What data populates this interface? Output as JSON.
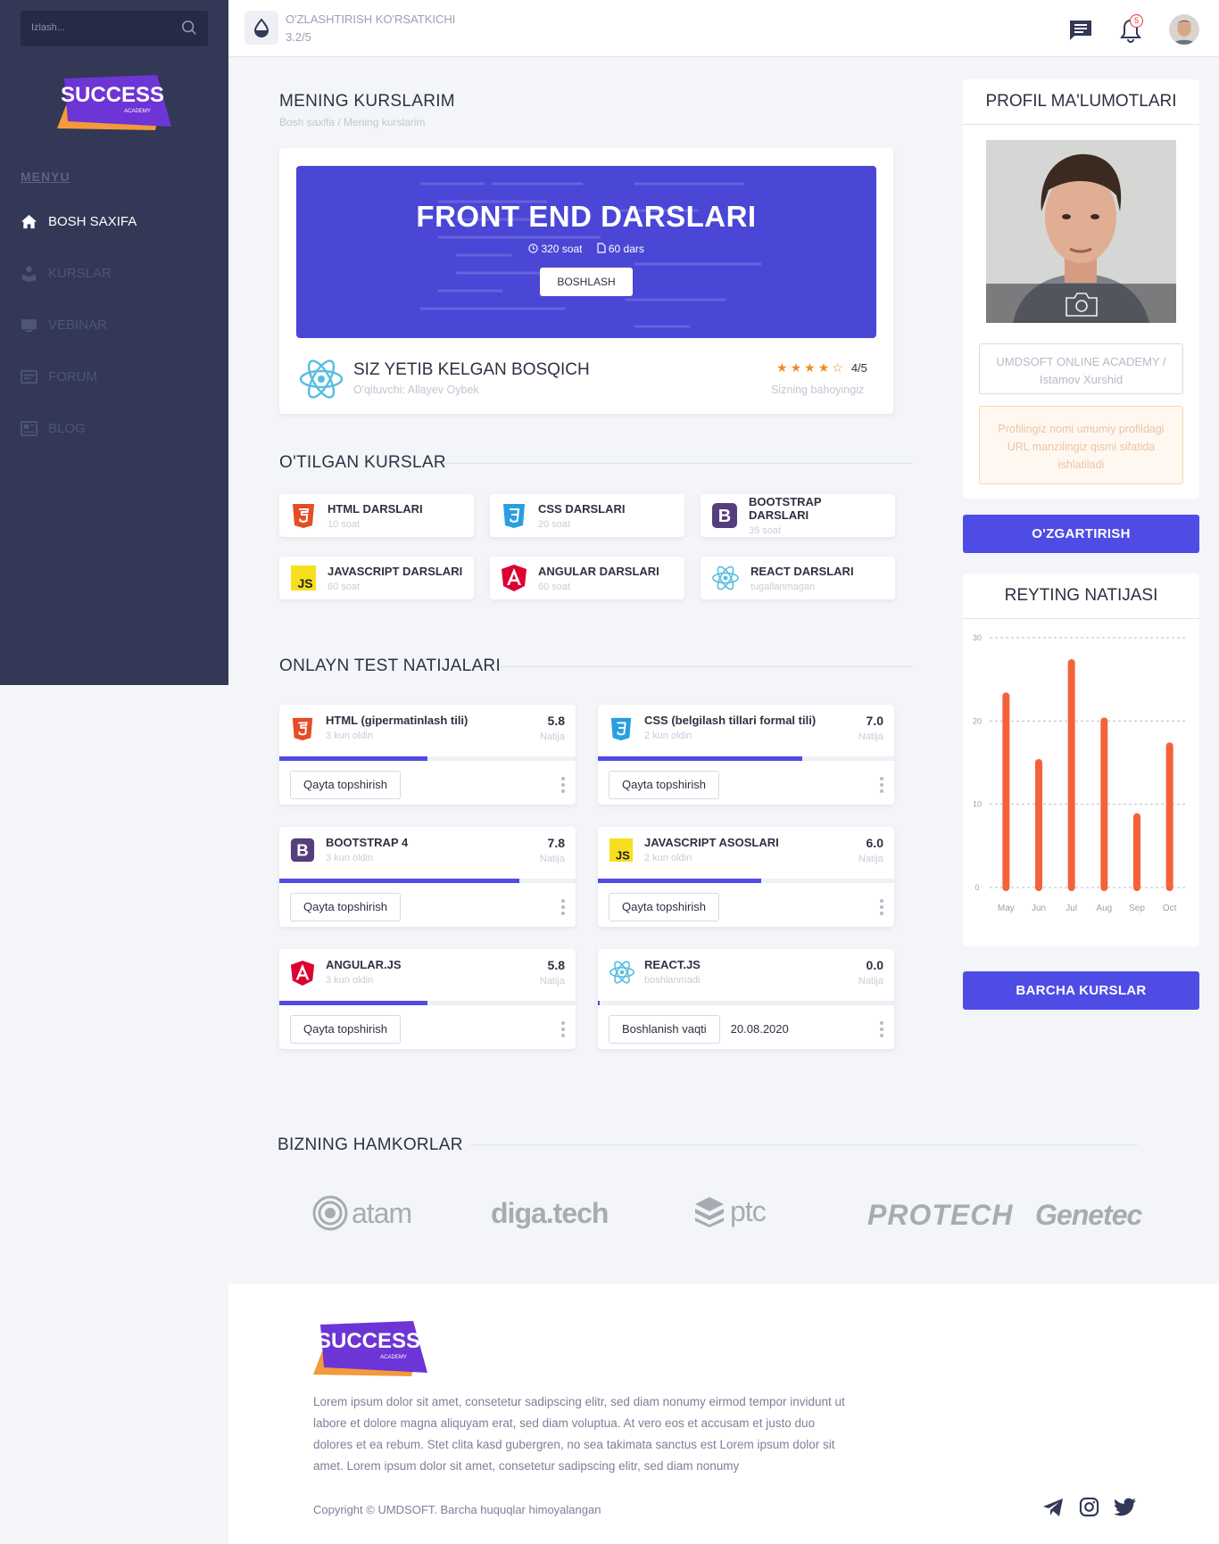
{
  "sidebar": {
    "search_placeholder": "Izlash...",
    "logo_text": "SUCCESS",
    "logo_sub": "ACADEMY",
    "menu_title": "MENYU",
    "items": [
      {
        "label": "BOSH SAXIFA",
        "icon": "home-icon",
        "active": true
      },
      {
        "label": "KURSLAR",
        "icon": "courses-icon",
        "active": false
      },
      {
        "label": "VEBINAR",
        "icon": "webinar-icon",
        "active": false
      },
      {
        "label": "FORUM",
        "icon": "forum-icon",
        "active": false
      },
      {
        "label": "BLOG",
        "icon": "blog-icon",
        "active": false
      }
    ]
  },
  "topbar": {
    "indicator_label": "O'ZLASHTIRISH KO'RSATKICHI",
    "indicator_value": "3.2/5",
    "notification_count": "5"
  },
  "main": {
    "title": "MENING KURSLARIM",
    "breadcrumb": "Bosh saxifa / Mening kurslarim",
    "hero": {
      "title": "FRONT END DARSLARI",
      "hours": "320 soat",
      "lessons": "60 dars",
      "button": "BOSHLASH"
    },
    "progress": {
      "title": "SIZ YETIB KELGAN BOSQICH",
      "teacher": "O'qituvchi: Allayev Oybek",
      "rating": "4/5",
      "rating_value": 4,
      "rating_label": "Sizning bahoyingiz"
    },
    "completed_title": "O'TILGAN KURSLAR",
    "completed": [
      {
        "name": "HTML DARSLARI",
        "sub": "10 soat",
        "icon": "html5-icon"
      },
      {
        "name": "CSS DARSLARI",
        "sub": "20 soat",
        "icon": "css3-icon"
      },
      {
        "name": "BOOTSTRAP DARSLARI",
        "sub": "35 soat",
        "icon": "bootstrap-icon"
      },
      {
        "name": "JAVASCRIPT DARSLARI",
        "sub": "60 soat",
        "icon": "javascript-icon"
      },
      {
        "name": "ANGULAR DARSLARI",
        "sub": "60 soat",
        "icon": "angular-icon"
      },
      {
        "name": "REACT DARSLARI",
        "sub": "tugallanmagan",
        "icon": "react-icon"
      }
    ],
    "tests_title": "ONLAYN TEST NATIJALARI",
    "tests": [
      {
        "name": "HTML (gipermatinlash tili)",
        "sub": "3 kun oldin",
        "score": "5.8",
        "score_label": "Natija",
        "progress": 0.5,
        "action": "Qayta topshirish",
        "date": "",
        "icon": "html5-icon"
      },
      {
        "name": "CSS (belgilash tillari formal tili)",
        "sub": "2 kun oldin",
        "score": "7.0",
        "score_label": "Natija",
        "progress": 0.69,
        "action": "Qayta topshirish",
        "date": "",
        "icon": "css3-icon"
      },
      {
        "name": "BOOTSTRAP 4",
        "sub": "3 kun oldin",
        "score": "7.8",
        "score_label": "Natija",
        "progress": 0.81,
        "action": "Qayta topshirish",
        "date": "",
        "icon": "bootstrap-icon"
      },
      {
        "name": "JAVASCRIPT ASOSLARI",
        "sub": "2 kun oldin",
        "score": "6.0",
        "score_label": "Natija",
        "progress": 0.55,
        "action": "Qayta topshirish",
        "date": "",
        "icon": "javascript-icon"
      },
      {
        "name": "ANGULAR.JS",
        "sub": "3 kun oldin",
        "score": "5.8",
        "score_label": "Natija",
        "progress": 0.5,
        "action": "Qayta topshirish",
        "date": "",
        "icon": "angular-icon"
      },
      {
        "name": "REACT.JS",
        "sub": "boshlanmadi",
        "score": "0.0",
        "score_label": "Natija",
        "progress": 0.0,
        "action": "Boshlanish vaqti",
        "date": "20.08.2020",
        "icon": "react-icon"
      }
    ]
  },
  "profile": {
    "title": "PROFIL MA'LUMOTLARI",
    "url_line1": "UMDSOFT ONLINE ACADEMY /",
    "url_line2": "Istamov Xurshid",
    "hint": "Profilingiz nomi umumiy profildagi URL manzilingiz qismi sifatida ishlatiladi",
    "edit_button": "O'ZGARTIRISH"
  },
  "rating": {
    "title": "REYTING NATIJASI",
    "all_courses_button": "BARCHA KURSLAR"
  },
  "chart_data": {
    "type": "bar",
    "title": "REYTING NATIJASI",
    "categories": [
      "May",
      "Jun",
      "Jul",
      "Aug",
      "Sep",
      "Oct"
    ],
    "values": [
      23,
      15,
      27,
      20,
      8.5,
      17
    ],
    "ylim": [
      0,
      30
    ],
    "yticks": [
      0,
      10,
      20,
      30
    ],
    "grid": true,
    "color": "#f4623a"
  },
  "partners": {
    "title": "BIZNING HAMKORLAR",
    "names": [
      "atam",
      "diga.tech",
      "ptc",
      "PROTECH",
      "Genetec"
    ]
  },
  "footer": {
    "logo_text": "SUCCESS",
    "logo_sub": "ACADEMY",
    "text": "Lorem ipsum dolor sit amet, consetetur sadipscing elitr, sed diam nonumy eirmod tempor invidunt ut labore et dolore magna aliquyam erat, sed diam voluptua. At vero eos et accusam et justo duo dolores et ea rebum. Stet clita kasd gubergren, no sea takimata sanctus est Lorem ipsum dolor sit amet. Lorem ipsum dolor sit amet, consetetur sadipscing elitr, sed diam nonumy",
    "copyright": "Copyright © UMDSOFT. Barcha huquqlar himoyalangan",
    "socials": [
      "telegram-icon",
      "instagram-icon",
      "twitter-icon"
    ]
  },
  "colors": {
    "sidebar": "#323856",
    "accent": "#4f4ce6",
    "chart_bar": "#f4623a",
    "star": "#f28c1e"
  }
}
